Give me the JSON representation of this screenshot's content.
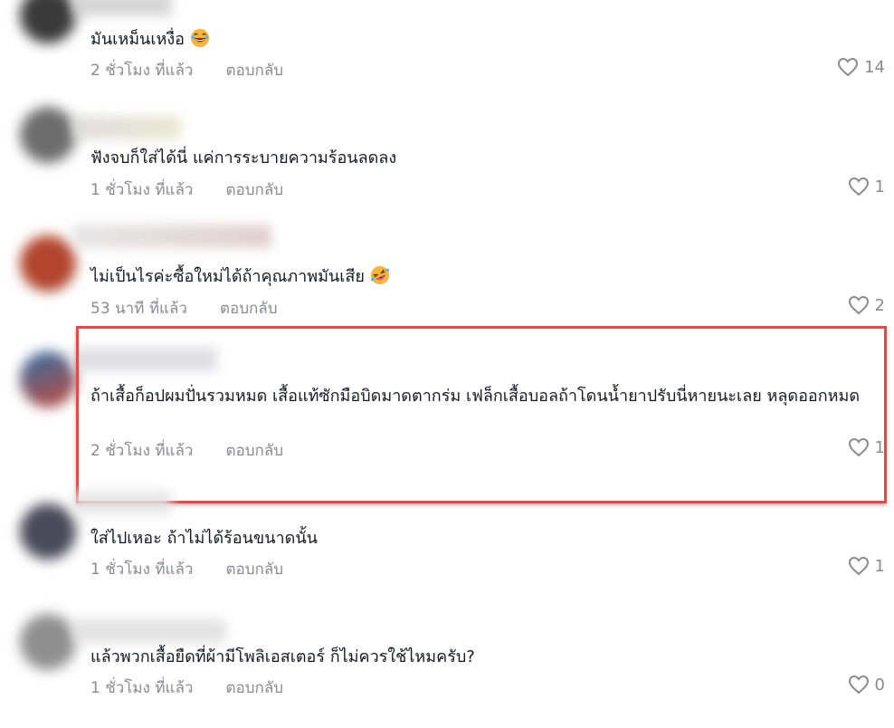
{
  "comments": [
    {
      "text": "มันเหม็นเหงื่อ",
      "emoji": "laughing-face-emoji",
      "time": "2 ชั่วโมง ที่แล้ว",
      "reply": "ตอบกลับ",
      "likes": "14"
    },
    {
      "text": "ฟังจบก็ใส่ได้นี่ แค่การระบายความร้อนลดลง",
      "time": "1 ชั่วโมง ที่แล้ว",
      "reply": "ตอบกลับ",
      "likes": "1"
    },
    {
      "text": "ไม่เป็นไรค่ะซื้อใหม่ได้ถ้าคุณภาพมันเสีย",
      "emoji": "rolling-laughing-face-emoji",
      "time": "53 นาที ที่แล้ว",
      "reply": "ตอบกลับ",
      "likes": "2"
    },
    {
      "text": "ถ้าเสื้อก็อปผมปั่นรวมหมด เสื้อแท้ซักมือบิดมาดตากร่ม เฟล็กเสื้อบอลถ้าโดนน้ำยาปรับนี่หายนะเลย หลุดออกหมด",
      "time": "2 ชั่วโมง ที่แล้ว",
      "reply": "ตอบกลับ",
      "likes": "1"
    },
    {
      "text": "ใส่ไปเหอะ ถ้าไม่ได้ร้อนขนาดนั้น",
      "time": "1 ชั่วโมง ที่แล้ว",
      "reply": "ตอบกลับ",
      "likes": "1"
    },
    {
      "text": "แล้วพวกเสื้อยืดที่ผ้ามีโพลิเอสเตอร์ ก็ไม่ควรใช้ไหมครับ?",
      "time": "1 ชั่วโมง ที่แล้ว",
      "reply": "ตอบกลับ",
      "likes": "0"
    }
  ],
  "colors": {
    "text": "#161823",
    "meta": "#8a8b91",
    "highlight_border": "#e04a4a"
  }
}
